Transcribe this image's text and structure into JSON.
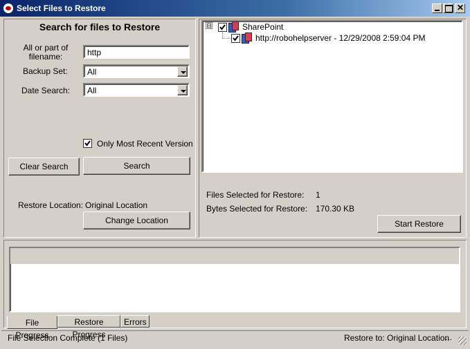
{
  "window": {
    "title": "Select Files to Restore"
  },
  "search": {
    "heading": "Search for files to Restore",
    "filename_label": "All or part of filename:",
    "filename_value": "http",
    "backup_set_label": "Backup Set:",
    "backup_set_value": "All",
    "date_search_label": "Date Search:",
    "date_search_value": "All",
    "recent_version_label": "Only Most Recent Version",
    "clear_label": "Clear Search",
    "search_label": "Search"
  },
  "restore_location": {
    "label": "Restore Location:",
    "value": "Original Location",
    "change_label": "Change Location"
  },
  "tree": {
    "root": "SharePoint",
    "child": "http://robohelpserver - 12/29/2008 2:59:04 PM",
    "expander": "⊟"
  },
  "summary": {
    "files_label": "Files Selected for Restore:",
    "files_value": "1",
    "bytes_label": "Bytes Selected for Restore:",
    "bytes_value": "170.30 KB",
    "start_label": "Start Restore"
  },
  "tabs": [
    "File Progress",
    "Restore Progress",
    "Errors"
  ],
  "status": {
    "left": "File Selection Complete (1 Files)",
    "right": "Restore to: Original Location",
    "dots": "..."
  }
}
